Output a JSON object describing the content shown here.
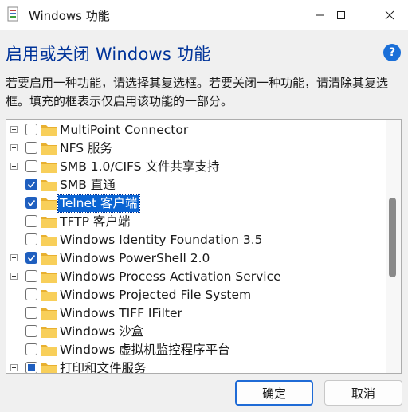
{
  "window": {
    "title": "Windows 功能"
  },
  "header": {
    "heading": "启用或关闭 Windows 功能",
    "description": "若要启用一种功能，请选择其复选框。若要关闭一种功能，请清除其复选框。填充的框表示仅启用该功能的一部分。"
  },
  "features": [
    {
      "label": "MultiPoint Connector",
      "expandable": true,
      "state": "unchecked",
      "selected": false
    },
    {
      "label": "NFS 服务",
      "expandable": true,
      "state": "unchecked",
      "selected": false
    },
    {
      "label": "SMB 1.0/CIFS 文件共享支持",
      "expandable": true,
      "state": "unchecked",
      "selected": false
    },
    {
      "label": "SMB 直通",
      "expandable": false,
      "state": "checked",
      "selected": false
    },
    {
      "label": "Telnet 客户端",
      "expandable": false,
      "state": "checked",
      "selected": true
    },
    {
      "label": "TFTP 客户端",
      "expandable": false,
      "state": "unchecked",
      "selected": false
    },
    {
      "label": "Windows Identity Foundation 3.5",
      "expandable": false,
      "state": "unchecked",
      "selected": false
    },
    {
      "label": "Windows PowerShell 2.0",
      "expandable": true,
      "state": "checked",
      "selected": false
    },
    {
      "label": "Windows Process Activation Service",
      "expandable": true,
      "state": "unchecked",
      "selected": false
    },
    {
      "label": "Windows Projected File System",
      "expandable": false,
      "state": "unchecked",
      "selected": false
    },
    {
      "label": "Windows TIFF IFilter",
      "expandable": false,
      "state": "unchecked",
      "selected": false
    },
    {
      "label": "Windows 沙盒",
      "expandable": false,
      "state": "unchecked",
      "selected": false
    },
    {
      "label": "Windows 虚拟机监控程序平台",
      "expandable": false,
      "state": "unchecked",
      "selected": false
    },
    {
      "label": "打印和文件服务",
      "expandable": true,
      "state": "partial",
      "selected": false
    }
  ],
  "buttons": {
    "ok": "确定",
    "cancel": "取消"
  },
  "icons": {
    "app": "windows-features-icon",
    "help": "help-icon",
    "folder": "folder-icon"
  },
  "colors": {
    "heading": "#003399",
    "accent": "#1f5fbf",
    "selection": "#0a64d3",
    "folder": "#f5c242"
  }
}
